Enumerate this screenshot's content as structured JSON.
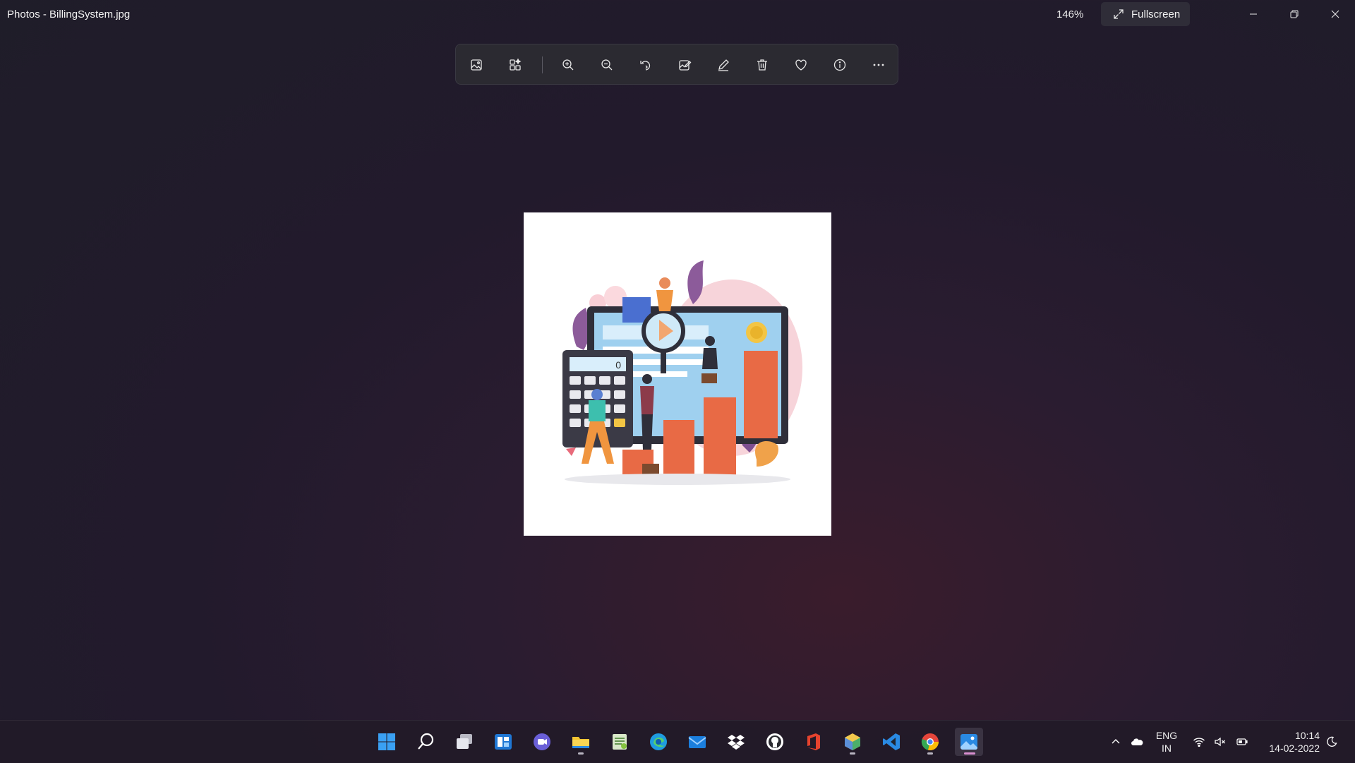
{
  "window": {
    "title": "Photos - BillingSystem.jpg",
    "zoom": "146%",
    "fullscreen_label": "Fullscreen",
    "controls": [
      "minimize-icon",
      "restore-icon",
      "close-icon"
    ]
  },
  "toolbar": {
    "buttons": [
      {
        "name": "view-image",
        "icon": "image-icon"
      },
      {
        "name": "collection",
        "icon": "gallery-icon"
      },
      {
        "name": "zoom-in",
        "icon": "zoom-in-icon"
      },
      {
        "name": "zoom-out",
        "icon": "zoom-out-icon"
      },
      {
        "name": "rotate",
        "icon": "rotate-icon"
      },
      {
        "name": "edit-image",
        "icon": "edit-image-icon"
      },
      {
        "name": "draw",
        "icon": "pen-icon"
      },
      {
        "name": "delete",
        "icon": "trash-icon"
      },
      {
        "name": "favorite",
        "icon": "heart-icon"
      },
      {
        "name": "file-info",
        "icon": "info-icon"
      },
      {
        "name": "more",
        "icon": "more-icon"
      }
    ]
  },
  "image": {
    "file": "BillingSystem.jpg",
    "calculator_display": "0"
  },
  "taskbar": {
    "apps": [
      {
        "name": "start",
        "icon": "windows-logo-icon"
      },
      {
        "name": "search",
        "icon": "search-icon"
      },
      {
        "name": "task-view",
        "icon": "task-view-icon"
      },
      {
        "name": "widgets",
        "icon": "widgets-icon"
      },
      {
        "name": "teams-chat",
        "icon": "teams-icon"
      },
      {
        "name": "file-explorer",
        "icon": "folder-icon",
        "running": true
      },
      {
        "name": "notepad-plus",
        "icon": "notepad-icon"
      },
      {
        "name": "edge",
        "icon": "edge-icon"
      },
      {
        "name": "mail",
        "icon": "mail-icon"
      },
      {
        "name": "dropbox",
        "icon": "dropbox-icon"
      },
      {
        "name": "github",
        "icon": "github-icon"
      },
      {
        "name": "office",
        "icon": "office-icon"
      },
      {
        "name": "cube-app",
        "icon": "cube-icon",
        "running": true
      },
      {
        "name": "vscode",
        "icon": "vscode-icon"
      },
      {
        "name": "chrome",
        "icon": "chrome-icon",
        "running": true
      },
      {
        "name": "photos",
        "icon": "photos-icon",
        "active": true
      }
    ],
    "tray": {
      "language_line1": "ENG",
      "language_line2": "IN",
      "time": "10:14",
      "date": "14-02-2022",
      "icons": [
        "chevron-up-icon",
        "onedrive-icon",
        "wifi-icon",
        "volume-muted-icon",
        "battery-icon",
        "focus-moon-icon"
      ]
    }
  }
}
